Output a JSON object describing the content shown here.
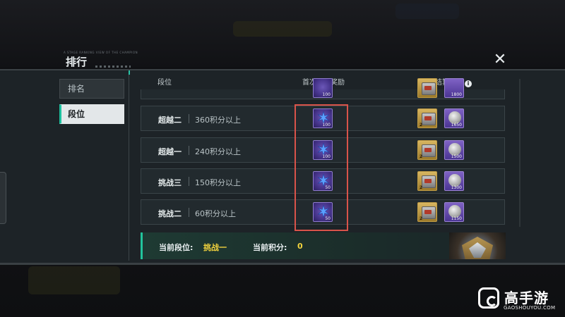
{
  "window": {
    "title": "排行",
    "subtitle_tiny": "A STAGE RANKING VIEW OF THE CHAMPION",
    "close_label": "✕"
  },
  "sidebar": {
    "items": [
      {
        "label": "排名",
        "active": false
      },
      {
        "label": "段位",
        "active": true
      }
    ]
  },
  "table": {
    "headers": {
      "rank": "段位",
      "first_reward": "首次晋升奖励",
      "settle_reward": "段位结算奖励",
      "info_icon": "i"
    },
    "partial_row": {
      "first_count": "100",
      "coin_count": "1800"
    },
    "rows": [
      {
        "name": "超越二",
        "requirement": "360积分以上",
        "first_count": "100",
        "chest_count": "2",
        "coin_count": "1650"
      },
      {
        "name": "超越一",
        "requirement": "240积分以上",
        "first_count": "100",
        "chest_count": "2",
        "coin_count": "1500"
      },
      {
        "name": "挑战三",
        "requirement": "150积分以上",
        "first_count": "50",
        "chest_count": "2",
        "coin_count": "1300"
      },
      {
        "name": "挑战二",
        "requirement": "60积分以上",
        "first_count": "50",
        "chest_count": "2",
        "coin_count": "1150"
      }
    ]
  },
  "current": {
    "rank_label": "当前段位:",
    "rank_value": "挑战一",
    "score_label": "当前积分:",
    "score_value": "0"
  },
  "watermark": {
    "brand": "高手游",
    "url": "GAOSHOUYOU.COM"
  },
  "colors": {
    "accent": "#22c49c",
    "highlight": "#d9534a",
    "value_yellow": "#f2d33d"
  }
}
